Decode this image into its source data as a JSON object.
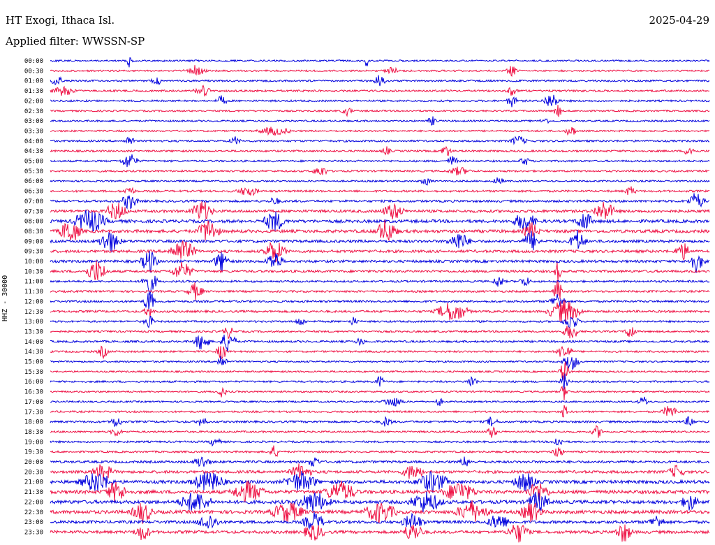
{
  "header": {
    "station": "HT Exogi, Ithaca Isl.",
    "date": "2025-04-29",
    "filter_label": "Applied filter: WWSSN-SP"
  },
  "channel_label": "HHZ - 30000",
  "colors": {
    "trace_a": "#0000dd",
    "trace_b": "#ee1144"
  },
  "chart_data": {
    "type": "line",
    "title": "",
    "xlabel": "",
    "ylabel": "HHZ - 30000",
    "grid": false,
    "rows": [
      {
        "label": "00:00",
        "color": "#0000dd",
        "activity": 1,
        "bursts": [
          [
            12,
            1.5,
            0.6
          ],
          [
            48,
            2.2,
            0.3
          ]
        ]
      },
      {
        "label": "00:30",
        "color": "#ee1144",
        "activity": 1,
        "bursts": [
          [
            22,
            1.2,
            2
          ],
          [
            52,
            1.0,
            1.5
          ],
          [
            70,
            1.2,
            1
          ]
        ]
      },
      {
        "label": "01:00",
        "color": "#0000dd",
        "activity": 1.1,
        "bursts": [
          [
            1,
            1.6,
            1
          ],
          [
            16,
            1.3,
            1
          ],
          [
            50,
            1.5,
            1
          ]
        ]
      },
      {
        "label": "01:30",
        "color": "#ee1144",
        "activity": 1.1,
        "bursts": [
          [
            2,
            1.2,
            2
          ],
          [
            23,
            1.5,
            1.5
          ],
          [
            70,
            1.0,
            1
          ]
        ]
      },
      {
        "label": "02:00",
        "color": "#0000dd",
        "activity": 1.1,
        "bursts": [
          [
            26,
            1.2,
            1
          ],
          [
            70,
            1.4,
            1
          ],
          [
            76,
            2.0,
            1.5
          ]
        ]
      },
      {
        "label": "02:30",
        "color": "#ee1144",
        "activity": 1,
        "bursts": [
          [
            45,
            1.0,
            1
          ],
          [
            77,
            1.5,
            0.8
          ]
        ]
      },
      {
        "label": "03:00",
        "color": "#0000dd",
        "activity": 1,
        "bursts": [
          [
            58,
            1.0,
            1
          ],
          [
            75,
            1.0,
            0.8
          ]
        ]
      },
      {
        "label": "03:30",
        "color": "#ee1144",
        "activity": 1,
        "bursts": [
          [
            34,
            1.0,
            3
          ],
          [
            79,
            1.5,
            1
          ]
        ]
      },
      {
        "label": "04:00",
        "color": "#0000dd",
        "activity": 1.1,
        "bursts": [
          [
            12,
            1.2,
            1
          ],
          [
            28,
            1.0,
            1
          ],
          [
            71,
            1.2,
            1.5
          ]
        ]
      },
      {
        "label": "04:30",
        "color": "#ee1144",
        "activity": 1.1,
        "bursts": [
          [
            51,
            1.0,
            0.8
          ],
          [
            60,
            1.5,
            1
          ],
          [
            97,
            1.4,
            1
          ]
        ]
      },
      {
        "label": "05:00",
        "color": "#0000dd",
        "activity": 1.1,
        "bursts": [
          [
            12,
            2.0,
            1.5
          ],
          [
            61,
            1.3,
            1
          ],
          [
            72,
            1.0,
            1
          ]
        ]
      },
      {
        "label": "05:30",
        "color": "#ee1144",
        "activity": 1.1,
        "bursts": [
          [
            41,
            1.2,
            1.5
          ],
          [
            62,
            1.0,
            2
          ]
        ]
      },
      {
        "label": "06:00",
        "color": "#0000dd",
        "activity": 1,
        "bursts": [
          [
            57,
            1.0,
            1
          ],
          [
            68,
            1.0,
            1
          ]
        ]
      },
      {
        "label": "06:30",
        "color": "#ee1144",
        "activity": 1.2,
        "bursts": [
          [
            12,
            1.2,
            1
          ],
          [
            30,
            1.2,
            2
          ],
          [
            88,
            1.2,
            1
          ]
        ]
      },
      {
        "label": "07:00",
        "color": "#0000dd",
        "activity": 1.3,
        "bursts": [
          [
            12,
            2.0,
            1.5
          ],
          [
            34,
            1.0,
            1
          ],
          [
            98,
            2.2,
            1.5
          ]
        ]
      },
      {
        "label": "07:30",
        "color": "#ee1144",
        "activity": 1.6,
        "bursts": [
          [
            10,
            2.2,
            2
          ],
          [
            23,
            2.6,
            2
          ],
          [
            52,
            2.0,
            2
          ],
          [
            84,
            2.5,
            2
          ]
        ]
      },
      {
        "label": "08:00",
        "color": "#0000dd",
        "activity": 1.8,
        "bursts": [
          [
            6,
            3.0,
            3
          ],
          [
            34,
            2.5,
            2
          ],
          [
            72,
            2.5,
            2
          ],
          [
            81,
            2.5,
            1.5
          ]
        ]
      },
      {
        "label": "08:30",
        "color": "#ee1144",
        "activity": 1.8,
        "bursts": [
          [
            3,
            3.0,
            2
          ],
          [
            24,
            3.0,
            2
          ],
          [
            51,
            2.8,
            2
          ],
          [
            73,
            2.0,
            1.5
          ]
        ]
      },
      {
        "label": "09:00",
        "color": "#0000dd",
        "activity": 1.6,
        "bursts": [
          [
            9,
            2.8,
            2
          ],
          [
            62,
            2.2,
            2
          ],
          [
            73,
            2.5,
            1.5
          ],
          [
            80,
            2.6,
            1.5
          ]
        ]
      },
      {
        "label": "09:30",
        "color": "#ee1144",
        "activity": 1.6,
        "bursts": [
          [
            20,
            2.8,
            2.5
          ],
          [
            34,
            2.8,
            2
          ],
          [
            96,
            2.0,
            1.5
          ]
        ]
      },
      {
        "label": "10:00",
        "color": "#0000dd",
        "activity": 1.5,
        "bursts": [
          [
            15,
            3.0,
            1.5
          ],
          [
            26,
            2.5,
            1.5
          ],
          [
            34,
            2.6,
            1.5
          ],
          [
            98,
            2.5,
            1.5
          ]
        ]
      },
      {
        "label": "10:30",
        "color": "#ee1144",
        "activity": 1.4,
        "bursts": [
          [
            7,
            2.8,
            2
          ],
          [
            20,
            2.2,
            2
          ],
          [
            77,
            2.5,
            0.6
          ]
        ]
      },
      {
        "label": "11:00",
        "color": "#0000dd",
        "activity": 1.2,
        "bursts": [
          [
            15,
            3.0,
            1.5
          ],
          [
            68,
            1.5,
            1
          ],
          [
            72,
            1.3,
            1
          ]
        ]
      },
      {
        "label": "11:30",
        "color": "#ee1144",
        "activity": 1.2,
        "bursts": [
          [
            22,
            2.0,
            1.5
          ],
          [
            77,
            3.0,
            0.8
          ]
        ]
      },
      {
        "label": "12:00",
        "color": "#0000dd",
        "activity": 1.2,
        "bursts": [
          [
            15,
            3.0,
            1
          ],
          [
            77,
            2.0,
            1.5
          ]
        ]
      },
      {
        "label": "12:30",
        "color": "#ee1144",
        "activity": 1.3,
        "bursts": [
          [
            15,
            1.5,
            1
          ],
          [
            61,
            2.5,
            3
          ],
          [
            78,
            3.0,
            3
          ]
        ]
      },
      {
        "label": "13:00",
        "color": "#0000dd",
        "activity": 1.1,
        "bursts": [
          [
            15,
            1.5,
            1
          ],
          [
            38,
            1.0,
            1
          ],
          [
            46,
            1.0,
            0.8
          ],
          [
            79,
            2.0,
            1.5
          ]
        ]
      },
      {
        "label": "13:30",
        "color": "#ee1144",
        "activity": 1.1,
        "bursts": [
          [
            27,
            1.5,
            1
          ],
          [
            79,
            2.0,
            1.5
          ],
          [
            88,
            2.0,
            1
          ]
        ]
      },
      {
        "label": "14:00",
        "color": "#0000dd",
        "activity": 1.2,
        "bursts": [
          [
            23,
            2.2,
            1.5
          ],
          [
            27,
            2.5,
            1.5
          ],
          [
            47,
            1.0,
            0.8
          ]
        ]
      },
      {
        "label": "14:30",
        "color": "#ee1144",
        "activity": 1.1,
        "bursts": [
          [
            8,
            1.5,
            1
          ],
          [
            26,
            2.0,
            1
          ],
          [
            78,
            2.0,
            1.5
          ]
        ]
      },
      {
        "label": "15:00",
        "color": "#0000dd",
        "activity": 1,
        "bursts": [
          [
            26,
            2.0,
            1
          ],
          [
            79,
            2.2,
            1.5
          ]
        ]
      },
      {
        "label": "15:30",
        "color": "#ee1144",
        "activity": 1,
        "bursts": [
          [
            78,
            2.5,
            1
          ]
        ]
      },
      {
        "label": "16:00",
        "color": "#0000dd",
        "activity": 1.1,
        "bursts": [
          [
            50,
            1.5,
            0.8
          ],
          [
            64,
            1.5,
            1
          ],
          [
            78,
            2.0,
            0.8
          ]
        ]
      },
      {
        "label": "16:30",
        "color": "#ee1144",
        "activity": 1,
        "bursts": [
          [
            26,
            1.2,
            1
          ],
          [
            78,
            2.0,
            0.8
          ]
        ]
      },
      {
        "label": "17:00",
        "color": "#0000dd",
        "activity": 1,
        "bursts": [
          [
            52,
            1.2,
            2
          ],
          [
            59,
            1.2,
            0.6
          ],
          [
            90,
            1.3,
            1
          ]
        ]
      },
      {
        "label": "17:30",
        "color": "#ee1144",
        "activity": 1.1,
        "bursts": [
          [
            78,
            2.0,
            0.6
          ],
          [
            94,
            1.5,
            1.5
          ]
        ]
      },
      {
        "label": "18:00",
        "color": "#0000dd",
        "activity": 1.2,
        "bursts": [
          [
            10,
            1.5,
            1
          ],
          [
            23,
            1.2,
            1
          ],
          [
            51,
            1.3,
            1
          ],
          [
            67,
            1.3,
            1
          ],
          [
            97,
            1.3,
            1
          ]
        ]
      },
      {
        "label": "18:30",
        "color": "#ee1144",
        "activity": 1.1,
        "bursts": [
          [
            10,
            1.2,
            1
          ],
          [
            67,
            1.5,
            1
          ],
          [
            83,
            1.5,
            1
          ]
        ]
      },
      {
        "label": "19:00",
        "color": "#0000dd",
        "activity": 1.1,
        "bursts": [
          [
            25,
            1.3,
            1
          ],
          [
            77,
            1.3,
            1
          ]
        ]
      },
      {
        "label": "19:30",
        "color": "#ee1144",
        "activity": 1.1,
        "bursts": [
          [
            34,
            1.5,
            1
          ],
          [
            77,
            1.5,
            1
          ]
        ]
      },
      {
        "label": "20:00",
        "color": "#0000dd",
        "activity": 1.4,
        "bursts": [
          [
            23,
            1.5,
            1.5
          ],
          [
            40,
            1.5,
            1
          ],
          [
            63,
            1.3,
            1
          ]
        ]
      },
      {
        "label": "20:30",
        "color": "#ee1144",
        "activity": 1.6,
        "bursts": [
          [
            8,
            2.0,
            2
          ],
          [
            38,
            2.0,
            2
          ],
          [
            55,
            2.0,
            2
          ],
          [
            95,
            1.5,
            1.5
          ]
        ]
      },
      {
        "label": "21:00",
        "color": "#0000dd",
        "activity": 1.9,
        "bursts": [
          [
            7,
            2.5,
            3
          ],
          [
            24,
            2.5,
            3
          ],
          [
            38,
            2.5,
            3
          ],
          [
            58,
            2.5,
            3
          ],
          [
            72,
            2.5,
            2
          ]
        ]
      },
      {
        "label": "21:30",
        "color": "#ee1144",
        "activity": 2,
        "bursts": [
          [
            10,
            2.5,
            2
          ],
          [
            30,
            2.5,
            3
          ],
          [
            44,
            2.5,
            3
          ],
          [
            62,
            2.5,
            3
          ],
          [
            74,
            2.5,
            2
          ]
        ]
      },
      {
        "label": "22:00",
        "color": "#0000dd",
        "activity": 2,
        "bursts": [
          [
            22,
            2.5,
            3
          ],
          [
            40,
            2.5,
            3
          ],
          [
            57,
            2.5,
            3
          ],
          [
            74,
            2.5,
            2
          ],
          [
            97,
            2.0,
            1.5
          ]
        ]
      },
      {
        "label": "22:30",
        "color": "#ee1144",
        "activity": 2,
        "bursts": [
          [
            14,
            2.5,
            2
          ],
          [
            36,
            2.5,
            3
          ],
          [
            50,
            2.5,
            3
          ],
          [
            64,
            2.5,
            3
          ],
          [
            73,
            2.5,
            2
          ]
        ]
      },
      {
        "label": "23:00",
        "color": "#0000dd",
        "activity": 1.7,
        "bursts": [
          [
            24,
            2.0,
            2
          ],
          [
            40,
            2.2,
            2
          ],
          [
            55,
            2.0,
            2
          ],
          [
            68,
            2.0,
            2
          ],
          [
            92,
            1.5,
            1.5
          ]
        ]
      },
      {
        "label": "23:30",
        "color": "#ee1144",
        "activity": 1.7,
        "bursts": [
          [
            14,
            2.0,
            1.5
          ],
          [
            40,
            2.0,
            2
          ],
          [
            55,
            2.2,
            2
          ],
          [
            71,
            2.5,
            2
          ],
          [
            87,
            2.5,
            1.5
          ]
        ]
      }
    ]
  }
}
